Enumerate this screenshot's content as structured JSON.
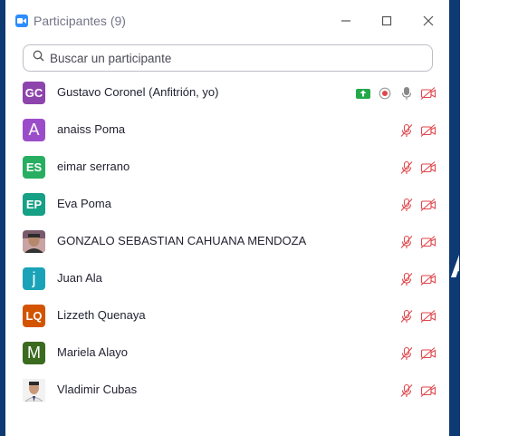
{
  "window": {
    "title": "Participantes (9)",
    "controls": {
      "minimize": "minimize-icon",
      "maximize": "maximize-icon",
      "close": "close-icon"
    }
  },
  "search": {
    "placeholder": "Buscar un participante",
    "icon": "search-icon"
  },
  "participants": [
    {
      "initials": "GC",
      "avatar_color": "#8e44ad",
      "name": "Gustavo Coronel (Anfitrión, yo)",
      "host": true
    },
    {
      "initials": "A",
      "avatar_color": "#9b4dc9",
      "name": "anaiss Poma"
    },
    {
      "initials": "ES",
      "avatar_color": "#27ae60",
      "name": "eimar serrano"
    },
    {
      "initials": "EP",
      "avatar_color": "#16a085",
      "name": "Eva Poma"
    },
    {
      "initials": "",
      "avatar_color": "#c9a3a3",
      "name": "GONZALO SEBASTIAN CAHUANA MENDOZA",
      "photo": true
    },
    {
      "initials": "j",
      "avatar_color": "#1aa3b8",
      "name": "Juan Ala"
    },
    {
      "initials": "LQ",
      "avatar_color": "#d35400",
      "name": "Lizzeth Quenaya"
    },
    {
      "initials": "M",
      "avatar_color": "#3b6b1f",
      "name": "Mariela Alayo"
    },
    {
      "initials": "",
      "avatar_color": "#e8e8e8",
      "name": "Vladimir Cubas",
      "photo": true
    }
  ],
  "colors": {
    "muted_red": "#e0474c",
    "share_green": "#23a84a",
    "record": "#e0474c"
  }
}
